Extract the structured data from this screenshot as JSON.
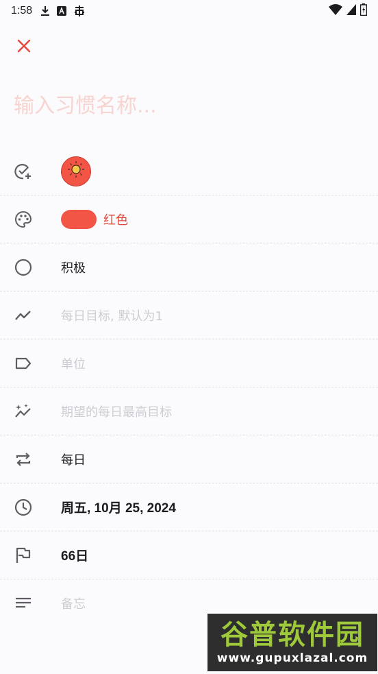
{
  "status_bar": {
    "time": "1:58",
    "left_icons": [
      "download-icon",
      "text-a-icon",
      "bug-icon"
    ],
    "right_icons": [
      "wifi-icon",
      "cellular-icon",
      "battery-charging-icon"
    ]
  },
  "header": {
    "close_icon": "close-icon",
    "close_color": "#e2473a"
  },
  "name_input": {
    "value": "",
    "placeholder": "输入习惯名称..."
  },
  "rows": {
    "icon": {
      "icon": "check-circle-plus-icon",
      "value_icon": "sun-icon",
      "circle_color": "#f25546"
    },
    "color": {
      "icon": "palette-icon",
      "label": "红色",
      "swatch": "#f25546"
    },
    "type": {
      "icon": "circle-icon",
      "value": "积极"
    },
    "goal": {
      "icon": "trending-icon",
      "placeholder": "每日目标, 默认为1"
    },
    "unit": {
      "icon": "label-icon",
      "placeholder": "单位"
    },
    "max_goal": {
      "icon": "sparkle-trend-icon",
      "placeholder": "期望的每日最高目标"
    },
    "repeat": {
      "icon": "repeat-icon",
      "value": "每日"
    },
    "start_date": {
      "icon": "clock-icon",
      "value": "周五, 10月 25, 2024"
    },
    "target": {
      "icon": "flag-icon",
      "value": "66日"
    },
    "notes": {
      "icon": "notes-icon",
      "placeholder": "备忘"
    }
  },
  "watermark": {
    "title": "谷普软件园",
    "url": "www.gupuxlazal.com"
  }
}
